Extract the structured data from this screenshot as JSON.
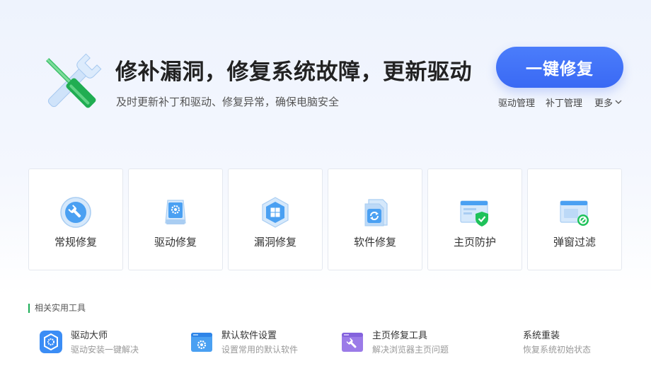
{
  "hero": {
    "title": "修补漏洞，修复系统故障，更新驱动",
    "subtitle": "及时更新补丁和驱动、修复异常，确保电脑安全",
    "fix_button": "一键修复",
    "icon": "wrench-screwdriver-icon"
  },
  "links": {
    "driver": "驱动管理",
    "patch": "补丁管理",
    "more": "更多"
  },
  "cards": [
    {
      "label": "常规修复",
      "icon": "wrench-circle-icon"
    },
    {
      "label": "驱动修复",
      "icon": "driver-gear-icon"
    },
    {
      "label": "漏洞修复",
      "icon": "windows-shield-icon"
    },
    {
      "label": "软件修复",
      "icon": "refresh-file-icon"
    },
    {
      "label": "主页防护",
      "icon": "browser-shield-icon"
    },
    {
      "label": "弹窗过滤",
      "icon": "popup-block-icon"
    }
  ],
  "tools_section": {
    "title": "相关实用工具",
    "items": [
      {
        "name": "驱动大师",
        "desc": "驱动安装一键解决",
        "icon": "driver-master-icon"
      },
      {
        "name": "默认软件设置",
        "desc": "设置常用的默认软件",
        "icon": "default-software-icon"
      },
      {
        "name": "主页修复工具",
        "desc": "解决浏览器主页问题",
        "icon": "homepage-repair-icon"
      },
      {
        "name": "系统重装",
        "desc": "恢复系统初始状态",
        "icon": ""
      }
    ]
  },
  "colors": {
    "accent_blue": "#3a69f4",
    "accent_green": "#1aad55",
    "page_bg_top": "#eef3fd"
  }
}
